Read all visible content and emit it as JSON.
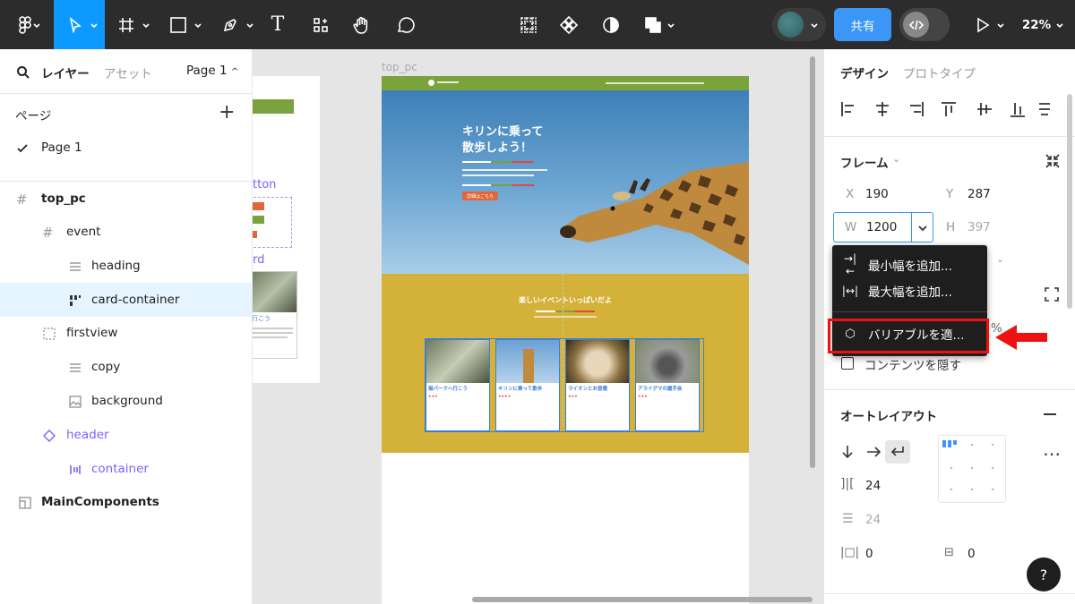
{
  "toolbar": {
    "share_label": "共有",
    "zoom": "22%",
    "text_tool": "T",
    "selected_tool": "move-tool"
  },
  "colors": {
    "accent": "#0d99ff",
    "toolbar": "#2c2c2c",
    "design_green": "#7aa33b",
    "design_mustard": "#d4b139",
    "annotation_red": "#ee1111",
    "purple": "#7b61ff"
  },
  "left_panel": {
    "tabs": {
      "layers": "レイヤー",
      "assets": "アセット"
    },
    "page_selector": "Page 1",
    "pages_title": "ページ",
    "pages": [
      "Page 1"
    ],
    "layers": [
      {
        "name": "top_pc",
        "icon": "frame-icon"
      },
      {
        "name": "event",
        "icon": "frame-icon"
      },
      {
        "name": "heading",
        "icon": "text-icon"
      },
      {
        "name": "card-container",
        "icon": "autolayout-grid-icon"
      },
      {
        "name": "firstview",
        "icon": "section-icon"
      },
      {
        "name": "copy",
        "icon": "text-icon"
      },
      {
        "name": "background",
        "icon": "image-icon"
      },
      {
        "name": "header",
        "icon": "component-instance-icon"
      },
      {
        "name": "container",
        "icon": "autolayout-icon"
      },
      {
        "name": "MainComponents",
        "icon": "page-frame-icon"
      }
    ]
  },
  "canvas": {
    "frame_label": "top_pc",
    "components_labels": {
      "button": "tton",
      "card": "rd"
    },
    "side_card": {
      "title": "行こう"
    },
    "design": {
      "hero_title_line1": "キリンに乗って",
      "hero_title_line2": "散歩しよう！",
      "hero_button": "詳細はこちら",
      "event_heading": "楽しいイベントいっぱいだよ",
      "cards": [
        {
          "title": "猫パークへ行こう",
          "stars": "★★★"
        },
        {
          "title": "キリンに乗って散歩",
          "stars": "★★★★"
        },
        {
          "title": "ライオンとお昼寝",
          "stars": "★★★"
        },
        {
          "title": "アライグマの握手会",
          "stars": "★★★"
        }
      ]
    }
  },
  "right_panel": {
    "tabs": {
      "design": "デザイン",
      "prototype": "プロトタイプ"
    },
    "frame_title": "フレーム",
    "x_label": "X",
    "x_value": "190",
    "y_label": "Y",
    "y_value": "287",
    "w_label": "W",
    "w_value": "1200",
    "h_label": "H",
    "h_value": "397",
    "percent_sign": "%",
    "clip_content_label": "コンテンツを隠す",
    "autolayout_title": "オートレイアウト",
    "gap_value": "24",
    "gap_value2": "24",
    "padding_h": "0",
    "padding_v": "0",
    "menu": {
      "items": [
        "最小幅を追加...",
        "最大幅を追加...",
        "バリアブルを適..."
      ]
    },
    "help": "?"
  }
}
